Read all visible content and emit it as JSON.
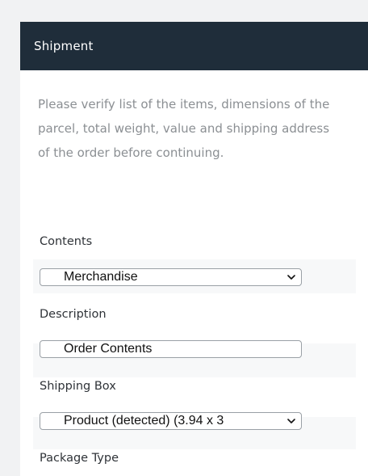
{
  "shipment": {
    "title": "Shipment",
    "intro": "Please verify list of the items, dimensions of the parcel, total weight, value and shipping address of the order before continuing."
  },
  "fields": {
    "contents": {
      "label": "Contents",
      "value": "Merchandise"
    },
    "description": {
      "label": "Description",
      "value": "Order Contents"
    },
    "shipping_box": {
      "label": "Shipping Box",
      "value": "Product (detected) (3.94 x 3"
    },
    "package_type": {
      "label": "Package Type"
    }
  },
  "icons": {
    "dropdown": "chevron-down-icon"
  }
}
